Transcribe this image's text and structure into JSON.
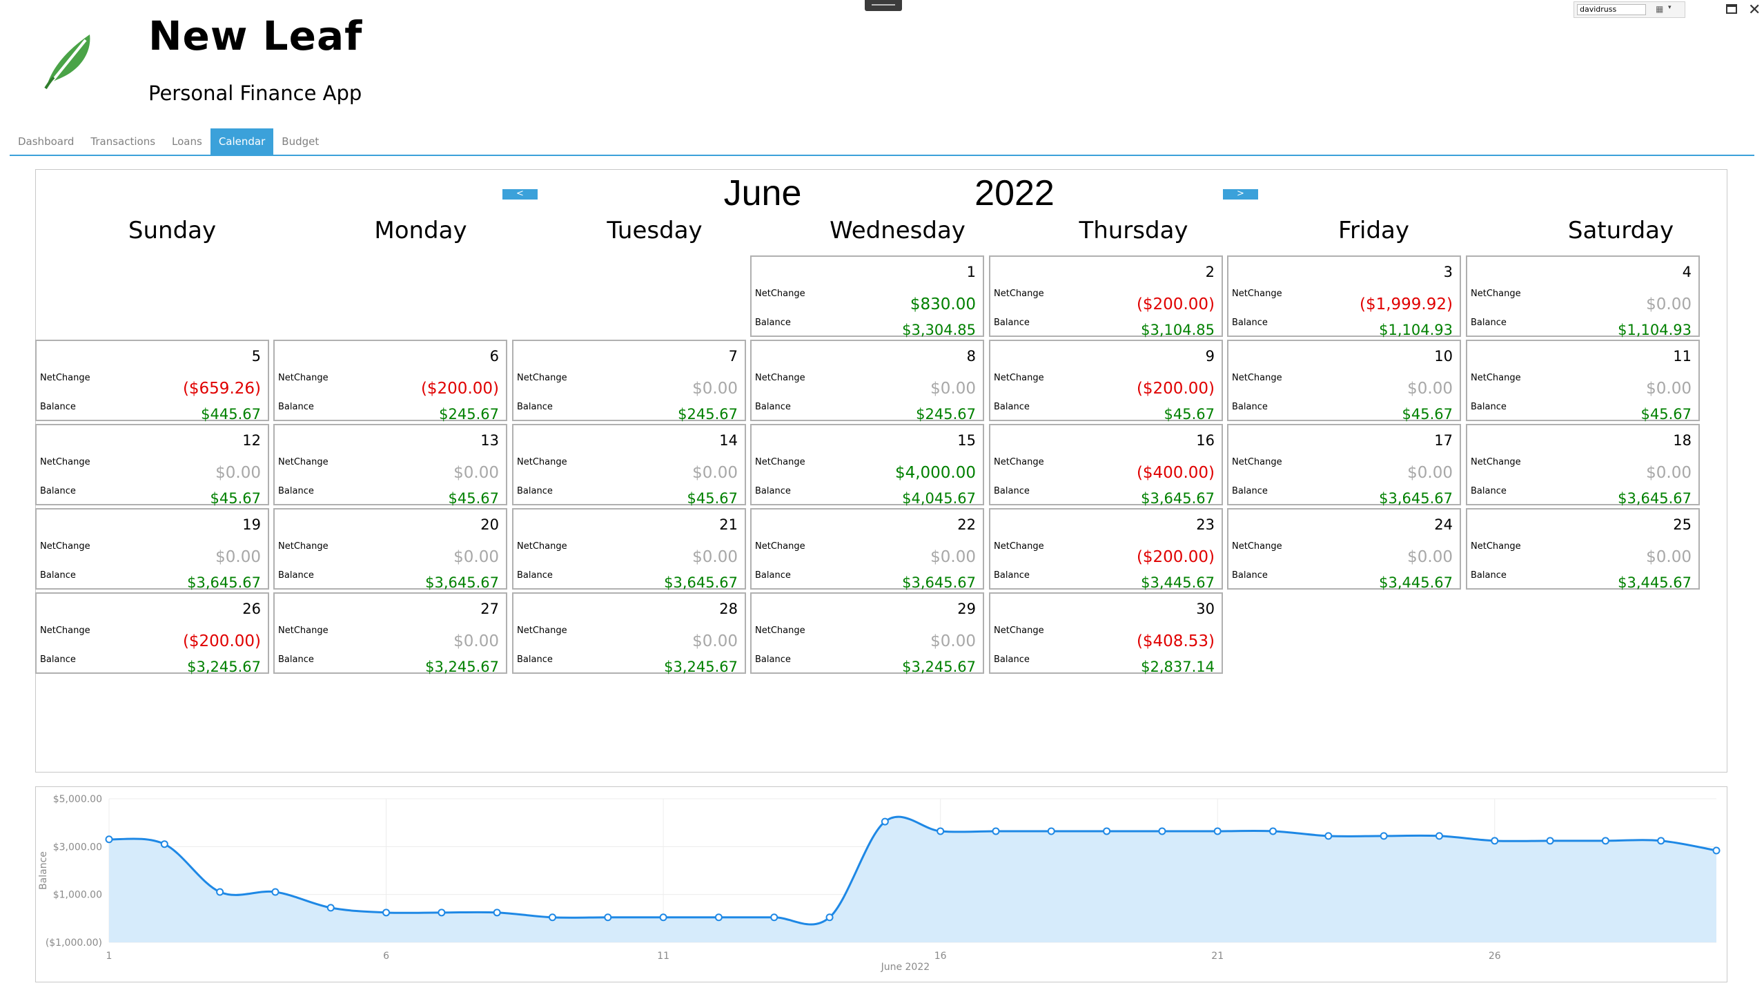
{
  "app": {
    "title": "New Leaf",
    "subtitle": "Personal Finance App"
  },
  "window": {
    "user": "davidruss"
  },
  "tabs": [
    "Dashboard",
    "Transactions",
    "Loans",
    "Calendar",
    "Budget"
  ],
  "active_tab": "Calendar",
  "calendar": {
    "month": "June",
    "year": "2022",
    "prev_label": "<",
    "next_label": ">",
    "weekdays": [
      "Sunday",
      "Monday",
      "Tuesday",
      "Wednesday",
      "Thursday",
      "Friday",
      "Saturday"
    ],
    "netchange_label": "NetChange",
    "balance_label": "Balance",
    "first_weekday_index": 3,
    "days": [
      {
        "day": "1",
        "net": "$830.00",
        "bal": "$3,304.85",
        "kind": "pos"
      },
      {
        "day": "2",
        "net": "($200.00)",
        "bal": "$3,104.85",
        "kind": "neg"
      },
      {
        "day": "3",
        "net": "($1,999.92)",
        "bal": "$1,104.93",
        "kind": "neg"
      },
      {
        "day": "4",
        "net": "$0.00",
        "bal": "$1,104.93",
        "kind": "zero"
      },
      {
        "day": "5",
        "net": "($659.26)",
        "bal": "$445.67",
        "kind": "neg"
      },
      {
        "day": "6",
        "net": "($200.00)",
        "bal": "$245.67",
        "kind": "neg"
      },
      {
        "day": "7",
        "net": "$0.00",
        "bal": "$245.67",
        "kind": "zero"
      },
      {
        "day": "8",
        "net": "$0.00",
        "bal": "$245.67",
        "kind": "zero"
      },
      {
        "day": "9",
        "net": "($200.00)",
        "bal": "$45.67",
        "kind": "neg"
      },
      {
        "day": "10",
        "net": "$0.00",
        "bal": "$45.67",
        "kind": "zero"
      },
      {
        "day": "11",
        "net": "$0.00",
        "bal": "$45.67",
        "kind": "zero"
      },
      {
        "day": "12",
        "net": "$0.00",
        "bal": "$45.67",
        "kind": "zero"
      },
      {
        "day": "13",
        "net": "$0.00",
        "bal": "$45.67",
        "kind": "zero"
      },
      {
        "day": "14",
        "net": "$0.00",
        "bal": "$45.67",
        "kind": "zero"
      },
      {
        "day": "15",
        "net": "$4,000.00",
        "bal": "$4,045.67",
        "kind": "pos"
      },
      {
        "day": "16",
        "net": "($400.00)",
        "bal": "$3,645.67",
        "kind": "neg"
      },
      {
        "day": "17",
        "net": "$0.00",
        "bal": "$3,645.67",
        "kind": "zero"
      },
      {
        "day": "18",
        "net": "$0.00",
        "bal": "$3,645.67",
        "kind": "zero"
      },
      {
        "day": "19",
        "net": "$0.00",
        "bal": "$3,645.67",
        "kind": "zero"
      },
      {
        "day": "20",
        "net": "$0.00",
        "bal": "$3,645.67",
        "kind": "zero"
      },
      {
        "day": "21",
        "net": "$0.00",
        "bal": "$3,645.67",
        "kind": "zero"
      },
      {
        "day": "22",
        "net": "$0.00",
        "bal": "$3,645.67",
        "kind": "zero"
      },
      {
        "day": "23",
        "net": "($200.00)",
        "bal": "$3,445.67",
        "kind": "neg"
      },
      {
        "day": "24",
        "net": "$0.00",
        "bal": "$3,445.67",
        "kind": "zero"
      },
      {
        "day": "25",
        "net": "$0.00",
        "bal": "$3,445.67",
        "kind": "zero"
      },
      {
        "day": "26",
        "net": "($200.00)",
        "bal": "$3,245.67",
        "kind": "neg"
      },
      {
        "day": "27",
        "net": "$0.00",
        "bal": "$3,245.67",
        "kind": "zero"
      },
      {
        "day": "28",
        "net": "$0.00",
        "bal": "$3,245.67",
        "kind": "zero"
      },
      {
        "day": "29",
        "net": "$0.00",
        "bal": "$3,245.67",
        "kind": "zero"
      },
      {
        "day": "30",
        "net": "($408.53)",
        "bal": "$2,837.14",
        "kind": "neg"
      }
    ]
  },
  "colors": {
    "accent": "#3ba1da",
    "positive": "#008000",
    "negative": "#e00000",
    "zero": "#a8a8a8",
    "chart_line": "#1e88e5",
    "chart_fill": "#d6ebfb"
  },
  "chart_data": {
    "type": "area",
    "title": "",
    "xlabel": "June 2022",
    "ylabel": "Balance",
    "x": [
      1,
      2,
      3,
      4,
      5,
      6,
      7,
      8,
      9,
      10,
      11,
      12,
      13,
      14,
      15,
      16,
      17,
      18,
      19,
      20,
      21,
      22,
      23,
      24,
      25,
      26,
      27,
      28,
      29,
      30
    ],
    "series": [
      {
        "values": [
          3304.85,
          3104.85,
          1104.93,
          1104.93,
          445.67,
          245.67,
          245.67,
          245.67,
          45.67,
          45.67,
          45.67,
          45.67,
          45.67,
          45.67,
          4045.67,
          3645.67,
          3645.67,
          3645.67,
          3645.67,
          3645.67,
          3645.67,
          3645.67,
          3445.67,
          3445.67,
          3445.67,
          3245.67,
          3245.67,
          3245.67,
          3245.67,
          2837.14
        ]
      }
    ],
    "x_ticks": [
      "1",
      "6",
      "11",
      "16",
      "21",
      "26"
    ],
    "y_ticks": [
      {
        "v": 5000,
        "label": "$5,000.00"
      },
      {
        "v": 3000,
        "label": "$3,000.00"
      },
      {
        "v": 1000,
        "label": "$1,000.00"
      },
      {
        "v": -1000,
        "label": "($1,000.00)"
      }
    ],
    "xlim": [
      1,
      30
    ],
    "ylim": [
      -1000,
      5000
    ],
    "grid": true,
    "legend": "none"
  }
}
